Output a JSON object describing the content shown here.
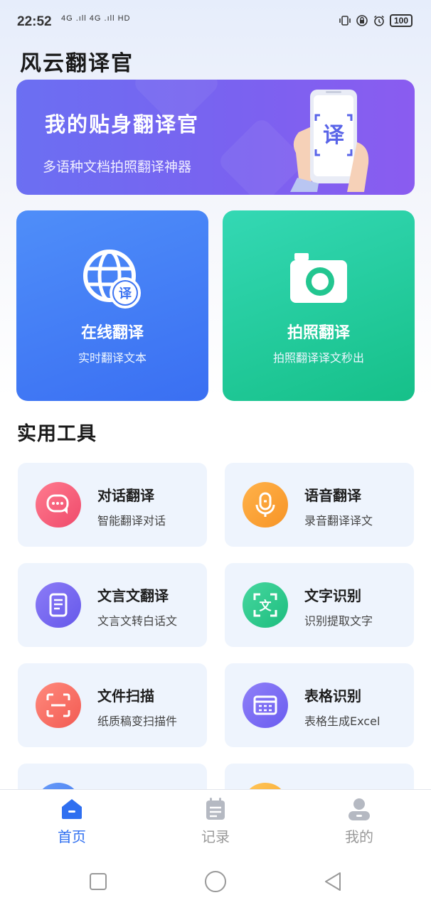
{
  "status_bar": {
    "time": "22:52",
    "network": "4G .ıll 4G .ıll HD",
    "battery": "100"
  },
  "app": {
    "title": "风云翻译官"
  },
  "banner": {
    "title": "我的贴身翻译官",
    "subtitle": "多语种文档拍照翻译神器",
    "badge_char": "译"
  },
  "big_cards": [
    {
      "title": "在线翻译",
      "subtitle": "实时翻译文本",
      "icon": "globe-translate-icon"
    },
    {
      "title": "拍照翻译",
      "subtitle": "拍照翻译译文秒出",
      "icon": "camera-icon"
    }
  ],
  "tools_section": {
    "title": "实用工具",
    "items": [
      {
        "title": "对话翻译",
        "subtitle": "智能翻译对话",
        "icon": "chat-bubble-icon"
      },
      {
        "title": "语音翻译",
        "subtitle": "录音翻译译文",
        "icon": "microphone-icon"
      },
      {
        "title": "文言文翻译",
        "subtitle": "文言文转白话文",
        "icon": "book-icon"
      },
      {
        "title": "文字识别",
        "subtitle": "识别提取文字",
        "icon": "text-scan-icon"
      },
      {
        "title": "文件扫描",
        "subtitle": "纸质稿变扫描件",
        "icon": "document-scan-icon"
      },
      {
        "title": "表格识别",
        "subtitle": "表格生成Excel",
        "icon": "table-icon"
      }
    ]
  },
  "tabbar": {
    "tabs": [
      {
        "label": "首页",
        "icon": "home-icon",
        "active": true
      },
      {
        "label": "记录",
        "icon": "clipboard-icon",
        "active": false
      },
      {
        "label": "我的",
        "icon": "user-icon",
        "active": false
      }
    ]
  },
  "colors": {
    "accent": "#2f6ff0",
    "banner": "#6b6ff2",
    "online_card": "#4f8ef9",
    "photo_card": "#1dc48f"
  }
}
